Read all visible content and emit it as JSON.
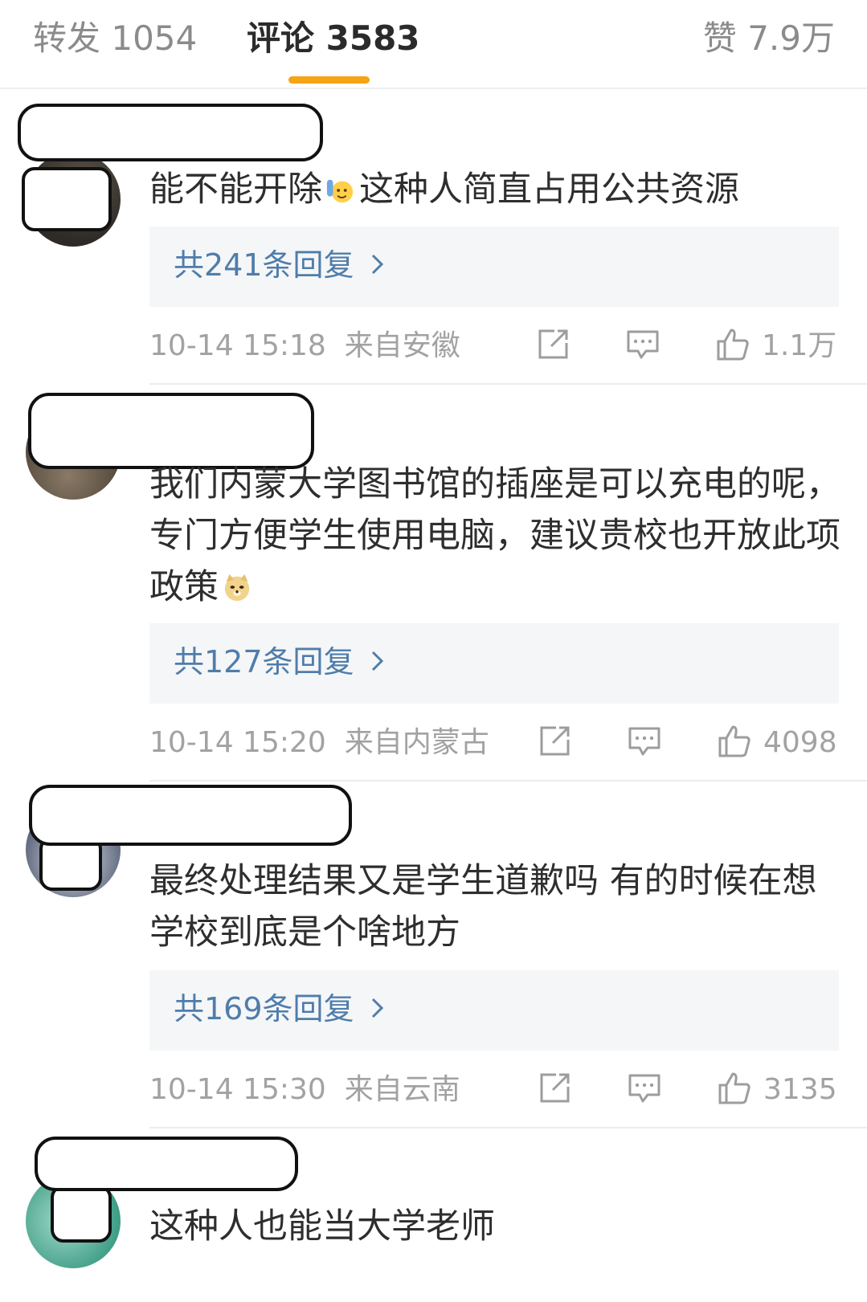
{
  "tabs": [
    {
      "label": "转发 1054",
      "active": false
    },
    {
      "label": "评论 3583",
      "active": true
    },
    {
      "label": "赞 7.9万",
      "active": false
    }
  ],
  "accent_color": "#f6a316",
  "link_color": "#4f7dab",
  "comments": [
    {
      "text_before": "能不能开除",
      "emoji": "raising-hand-emoji",
      "text_after": "这种人简直占用公共资源",
      "replies": "共241条回复",
      "time": "10-14 15:18",
      "location": "来自安徽",
      "likes": "1.1万"
    },
    {
      "text_before": "我们内蒙大学图书馆的插座是可以充电的呢，专门方便学生使用电脑，建议贵校也开放此项政策",
      "emoji": "doge-emoji",
      "text_after": "",
      "replies": "共127条回复",
      "time": "10-14 15:20",
      "location": "来自内蒙古",
      "likes": "4098"
    },
    {
      "text_before": "最终处理结果又是学生道歉吗 有的时候在想学校到底是个啥地方",
      "emoji": "",
      "text_after": "",
      "replies": "共169条回复",
      "time": "10-14 15:30",
      "location": "来自云南",
      "likes": "3135"
    },
    {
      "text_before": "这种人也能当大学老师",
      "emoji": "",
      "text_after": "",
      "replies": "",
      "time": "",
      "location": "",
      "likes": ""
    }
  ],
  "icons": {
    "chevron": "chevron-right-icon",
    "share": "share-icon",
    "reply": "comment-icon",
    "like": "thumbs-up-icon"
  }
}
